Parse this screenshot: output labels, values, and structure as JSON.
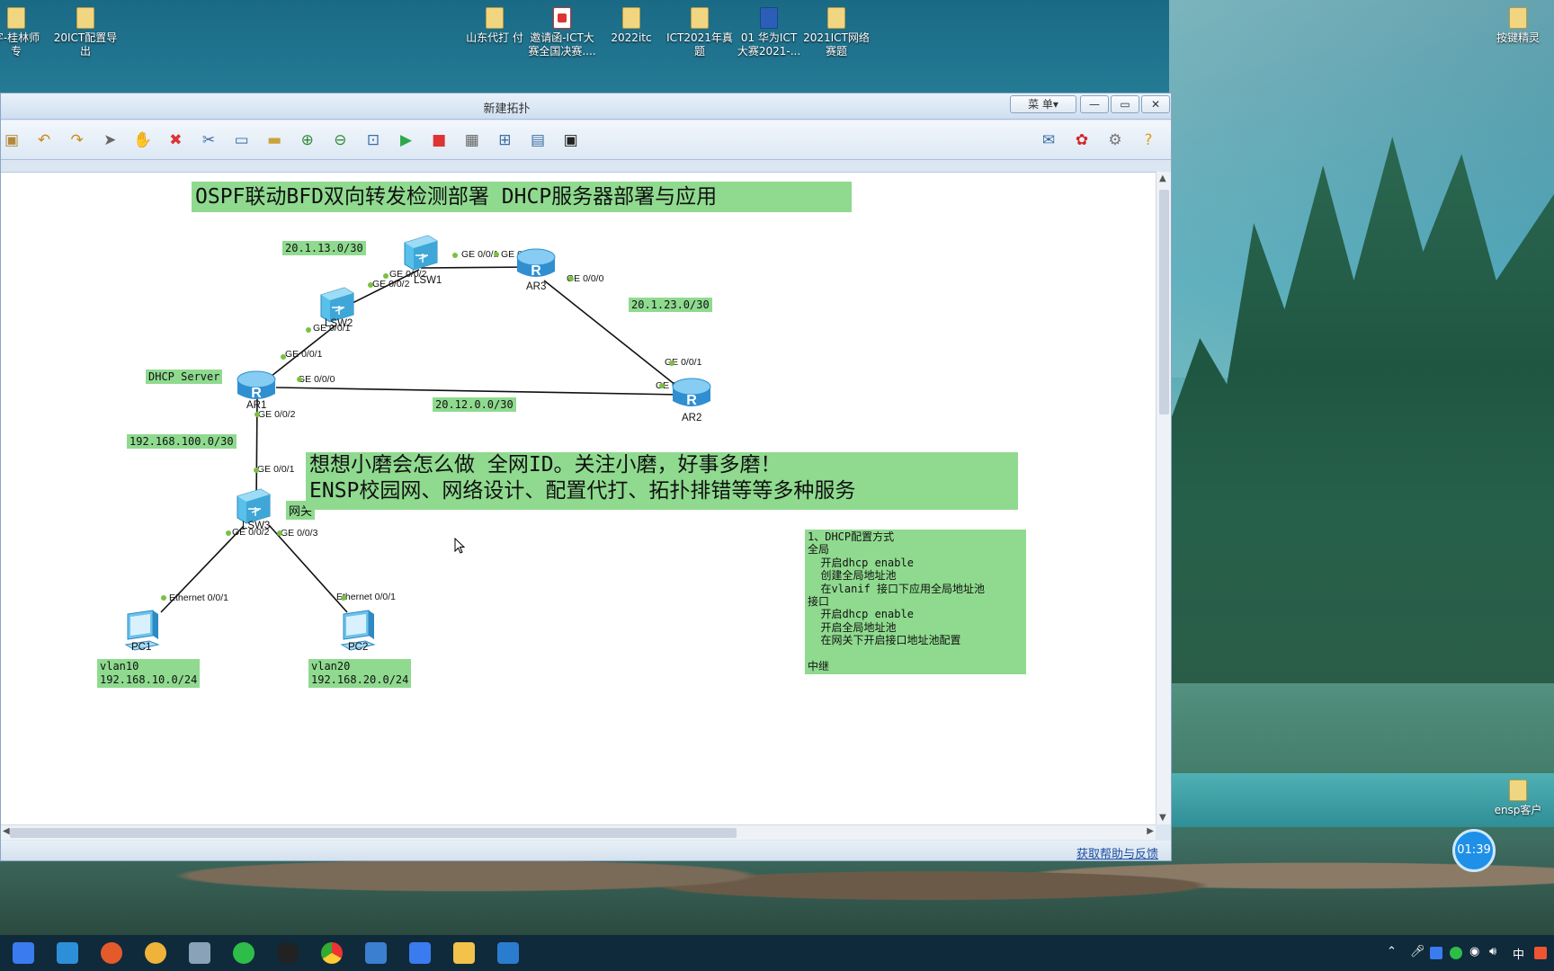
{
  "desktop": {
    "icons": [
      {
        "label": "字-桂林师\n专",
        "kind": "folder"
      },
      {
        "label": "20ICT配置导\n出",
        "kind": "folder"
      },
      {
        "label": "山东代打 付",
        "kind": "folder"
      },
      {
        "label": "邀请函-ICT大\n赛全国决赛....",
        "kind": "pdf"
      },
      {
        "label": "2022itc",
        "kind": "folder"
      },
      {
        "label": "ICT2021年真\n题",
        "kind": "folder"
      },
      {
        "label": "01 华为ICT\n大赛2021-...",
        "kind": "word"
      },
      {
        "label": "2021ICT网络\n赛题",
        "kind": "folder"
      },
      {
        "label": "按键精灵",
        "kind": "folder"
      },
      {
        "label": "ensp客户",
        "kind": "folder"
      }
    ]
  },
  "window": {
    "title": "新建拓扑",
    "menu_label": "菜 单▾",
    "min_label": "—",
    "max_label": "▭",
    "close_label": "✕",
    "help_link": "获取帮助与反馈"
  },
  "toolbar": {
    "buttons": [
      {
        "name": "save-icon",
        "glyph": "▣"
      },
      {
        "name": "undo-icon",
        "glyph": "↶"
      },
      {
        "name": "redo-icon",
        "glyph": "↷"
      },
      {
        "name": "select-icon",
        "glyph": "➤"
      },
      {
        "name": "hand-icon",
        "glyph": "✋"
      },
      {
        "name": "delete-icon",
        "glyph": "✖"
      },
      {
        "name": "delete-link-icon",
        "glyph": "✂"
      },
      {
        "name": "text-icon",
        "glyph": "▭"
      },
      {
        "name": "rectangle-icon",
        "glyph": "▬"
      },
      {
        "name": "zoom-in-icon",
        "glyph": "⊕"
      },
      {
        "name": "zoom-out-icon",
        "glyph": "⊖"
      },
      {
        "name": "fit-icon",
        "glyph": "⊡"
      },
      {
        "name": "start-icon",
        "glyph": "▶"
      },
      {
        "name": "stop-icon",
        "glyph": "■"
      },
      {
        "name": "capture-icon",
        "glyph": "▦"
      },
      {
        "name": "topology-icon",
        "glyph": "⊞"
      },
      {
        "name": "table-icon",
        "glyph": "▤"
      },
      {
        "name": "terminal-icon",
        "glyph": "▣"
      }
    ],
    "right_buttons": [
      {
        "name": "chat-icon",
        "glyph": "✉"
      },
      {
        "name": "huawei-icon",
        "glyph": "✿"
      },
      {
        "name": "settings-icon",
        "glyph": "⚙"
      },
      {
        "name": "help-icon",
        "glyph": "?"
      }
    ]
  },
  "topology": {
    "title": "OSPF联动BFD双向转发检测部署 DHCP服务器部署与应用",
    "promo_line1": "想想小磨会怎么做 全网ID。关注小磨，好事多磨！",
    "promo_line2": "ENSP校园网、网络设计、配置代打、拓扑排错等等多种服务",
    "note": "1、DHCP配置方式\n全局\n  开启dhcp enable\n  创建全局地址池\n  在vlanif 接口下应用全局地址池\n接口\n  开启dhcp enable\n  开启全局地址池\n  在网关下开启接口地址池配置\n\n中继",
    "devices": {
      "ar1": "AR1",
      "ar2": "AR2",
      "ar3": "AR3",
      "lsw1": "LSW1",
      "lsw2": "LSW2",
      "lsw3": "LSW3",
      "pc1": "PC1",
      "pc2": "PC2"
    },
    "labels": {
      "net_13": "20.1.13.0/30",
      "net_23": "20.1.23.0/30",
      "net_12": "20.12.0.0/30",
      "net_100": "192.168.100.0/30",
      "dhcp_server": "DHCP Server",
      "gateway": "网关",
      "pc1_vlan": "vlan10",
      "pc1_net": "192.168.10.0/24",
      "pc2_vlan": "vlan20",
      "pc2_net": "192.168.20.0/24"
    },
    "ports": {
      "lsw1_ge001": "GE 0/0/1",
      "ar3_ge001": "GE 0/0/1",
      "lsw1_ge002": "GE 0/0/2",
      "lsw2_ge002": "GE 0/0/2",
      "lsw2_ge001": "GE 0/0/1",
      "ar3_ge000": "GE 0/0/0",
      "ar1_ge001": "GE 0/0/1",
      "ar1_ge000": "GE 0/0/0",
      "ar2_ge001": "GE 0/0/1",
      "ar2_ge000": "GE 0/0/0",
      "ar1_ge002": "GE 0/0/2",
      "lsw3_ge001": "GE 0/0/1",
      "lsw3_ge002": "GE 0/0/2",
      "lsw3_ge003": "GE 0/0/3",
      "pc1_eth": "Ethernet 0/0/1",
      "pc2_eth": "Ethernet 0/0/1"
    }
  },
  "tray": {
    "ime": "中",
    "clock_badge": "01:39"
  },
  "colors": {
    "label_bg": "#8fda8f",
    "link": "#111111",
    "router": "#3aa0dc",
    "switch": "#4bb6e4",
    "taskbar": "#0f2a3a"
  }
}
